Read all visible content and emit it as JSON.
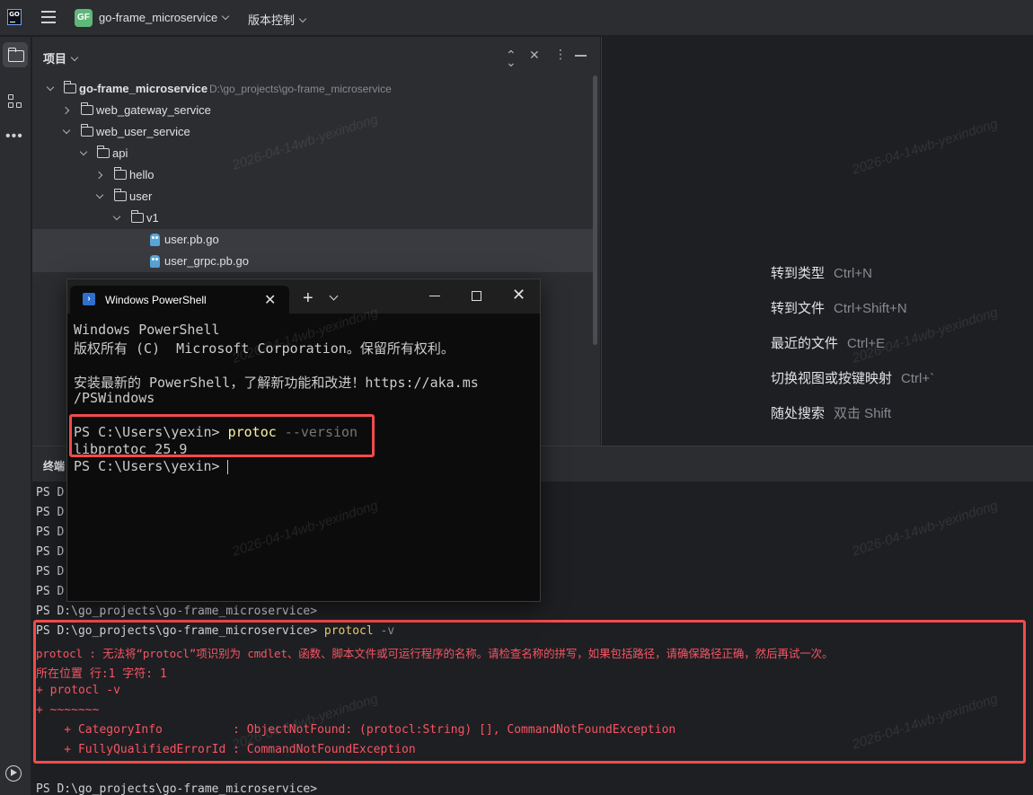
{
  "topbar": {
    "app_logo_text": "GO",
    "project_badge": "GF",
    "project_name": "go-frame_microservice",
    "vcs_label": "版本控制"
  },
  "sidebar": {
    "icons": [
      "folder-icon",
      "structure-icon",
      "more-icon",
      "run-icon"
    ]
  },
  "project_panel": {
    "title": "项目",
    "tree": [
      {
        "label": "go-frame_microservice",
        "path": "D:\\go_projects\\go-frame_microservice",
        "type": "folder",
        "expanded": true,
        "level": 0
      },
      {
        "label": "web_gateway_service",
        "type": "folder",
        "expanded": false,
        "level": 1
      },
      {
        "label": "web_user_service",
        "type": "folder",
        "expanded": true,
        "level": 1
      },
      {
        "label": "api",
        "type": "folder",
        "expanded": true,
        "level": 2
      },
      {
        "label": "hello",
        "type": "folder",
        "expanded": false,
        "level": 3
      },
      {
        "label": "user",
        "type": "folder",
        "expanded": true,
        "level": 3
      },
      {
        "label": "v1",
        "type": "folder",
        "expanded": true,
        "level": 4
      },
      {
        "label": "user.pb.go",
        "type": "go-file",
        "level": 5,
        "selected": true
      },
      {
        "label": "user_grpc.pb.go",
        "type": "go-file",
        "level": 5,
        "selected": true
      }
    ]
  },
  "editor_hints": [
    {
      "label": "转到类型",
      "shortcut": "Ctrl+N"
    },
    {
      "label": "转到文件",
      "shortcut": "Ctrl+Shift+N"
    },
    {
      "label": "最近的文件",
      "shortcut": "Ctrl+E"
    },
    {
      "label": "切换视图或按键映射",
      "shortcut": "Ctrl+`"
    },
    {
      "label": "随处搜索",
      "shortcut": "双击 Shift"
    }
  ],
  "terminal": {
    "title": "终端",
    "lines": [
      {
        "text": "PS D"
      },
      {
        "text": "PS D"
      },
      {
        "text": "PS D"
      },
      {
        "text": "PS D"
      },
      {
        "text": "PS D"
      },
      {
        "text": "PS D"
      },
      {
        "text": "PS D:\\go_projects\\go-frame_microservice>"
      }
    ],
    "command_prompt": "PS D:\\go_projects\\go-frame_microservice> ",
    "command": "protocl",
    "command_flag": " -v",
    "error_lines": [
      "protocl : 无法将“protocl”项识别为 cmdlet、函数、脚本文件或可运行程序的名称。请检查名称的拼写，如果包括路径，请确保路径正确，然后再试一次。",
      "所在位置 行:1 字符: 1",
      "+ protocl -v",
      "+ ~~~~~~~",
      "    + CategoryInfo          : ObjectNotFound: (protocl:String) [], CommandNotFoundException",
      "    + FullyQualifiedErrorId : CommandNotFoundException"
    ],
    "last_prompt": "PS D:\\go_projects\\go-frame_microservice>"
  },
  "powershell": {
    "tab_label": "Windows PowerShell",
    "lines": [
      "Windows PowerShell",
      "版权所有 (C)  Microsoft Corporation。保留所有权利。",
      "",
      "安装最新的 PowerShell，了解新功能和改进！https://aka.ms",
      "/PSWindows"
    ],
    "prompt": "PS C:\\Users\\yexin> ",
    "command": "protoc",
    "flag": " --version",
    "output": "libprotoc 25.9",
    "final_prompt": "PS C:\\Users\\yexin> "
  },
  "watermark": "2026-04-14wb-yexindong",
  "colors": {
    "highlight": "#f24b4b",
    "error_text": "#f75464",
    "command_text": "#e6c86e",
    "project_badge": "#5fb87a"
  }
}
